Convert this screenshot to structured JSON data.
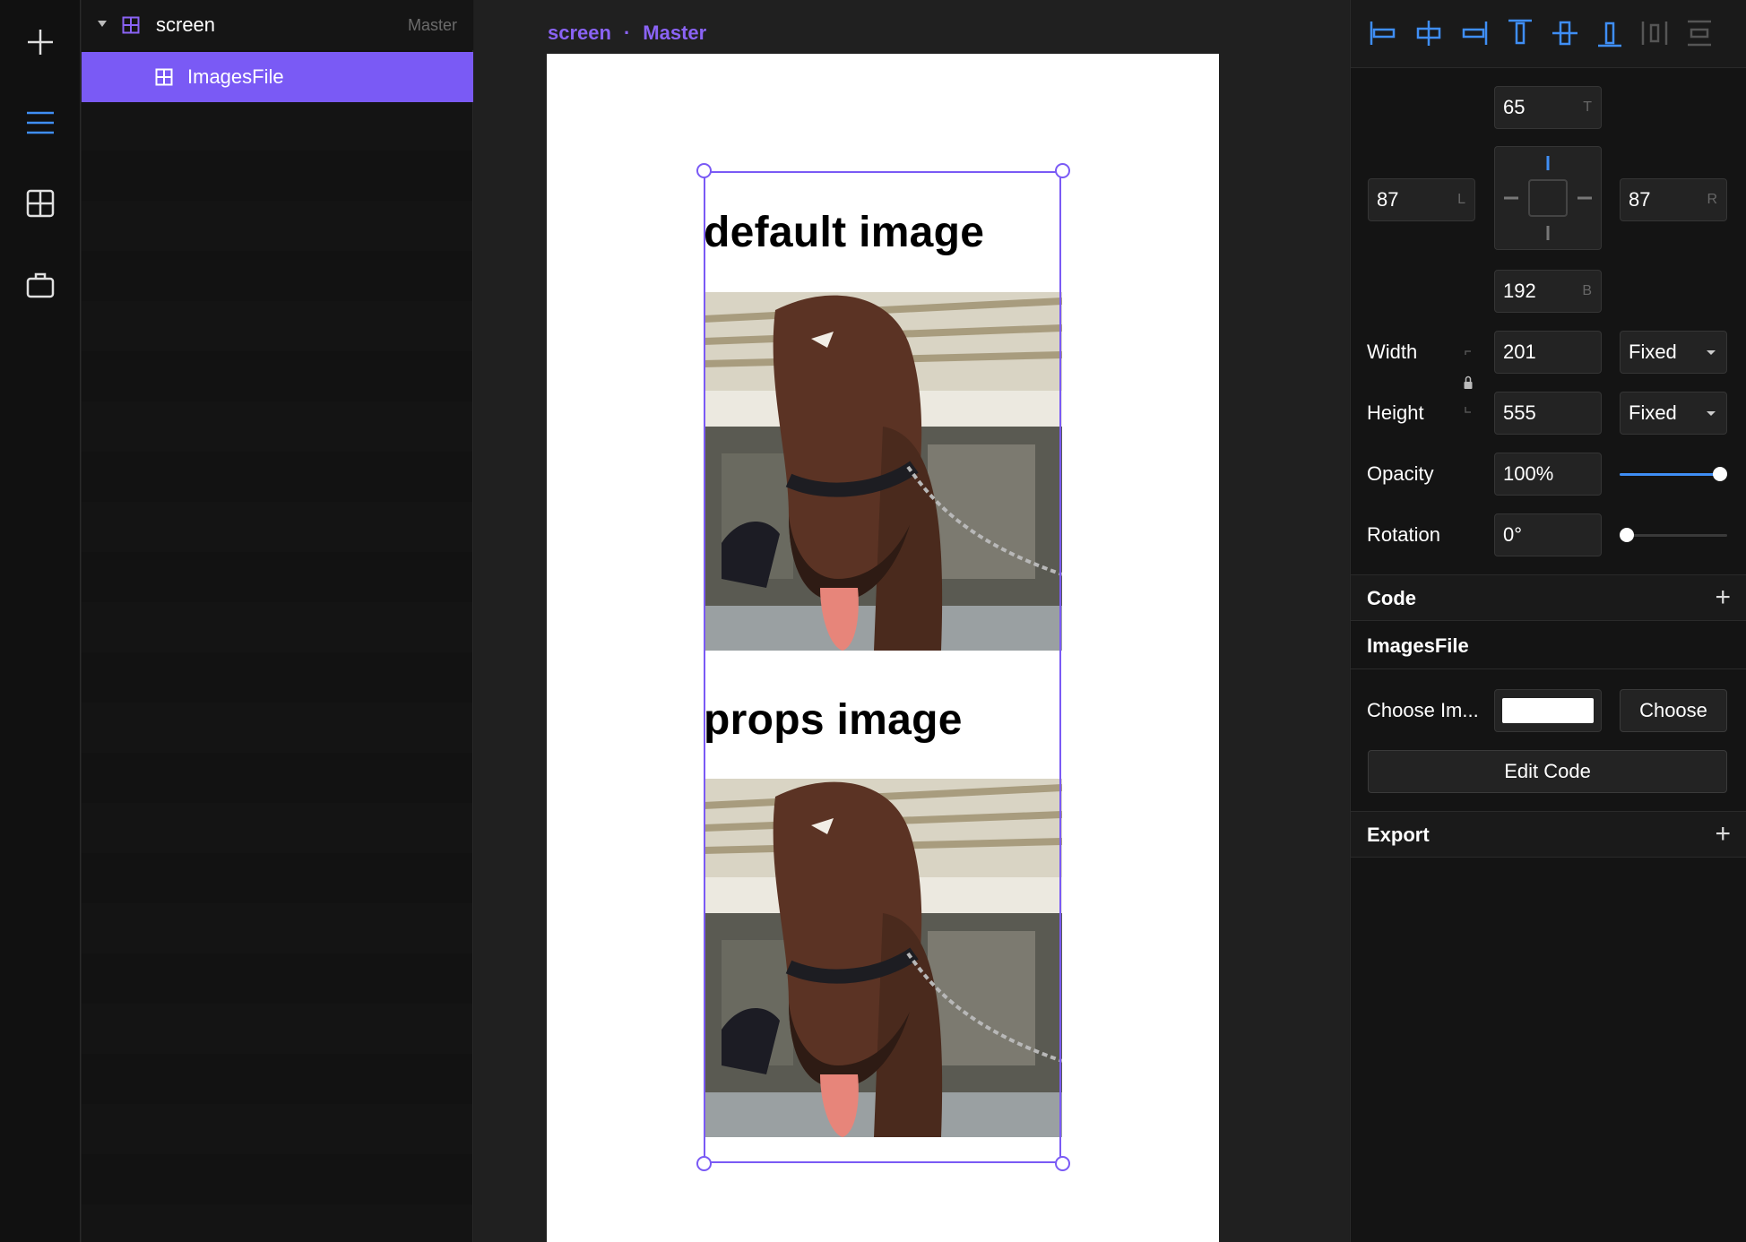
{
  "layers": {
    "items": [
      {
        "label": "screen",
        "tag": "Master"
      },
      {
        "label": "ImagesFile"
      }
    ]
  },
  "canvas": {
    "breadcrumb": [
      "screen",
      "Master"
    ],
    "separator": "·",
    "headings": [
      "default image",
      "props image"
    ]
  },
  "props": {
    "constraints": {
      "top": "65",
      "top_unit": "T",
      "left": "87",
      "left_unit": "L",
      "right": "87",
      "right_unit": "R",
      "bottom": "192",
      "bottom_unit": "B"
    },
    "width": {
      "label": "Width",
      "value": "201",
      "mode": "Fixed"
    },
    "height": {
      "label": "Height",
      "value": "555",
      "mode": "Fixed"
    },
    "opacity": {
      "label": "Opacity",
      "value": "100%",
      "level": 1.0
    },
    "rotation": {
      "label": "Rotation",
      "value": "0°",
      "level": 0.0
    },
    "code_section": {
      "title": "Code",
      "add": "+"
    },
    "component_section": {
      "title": "ImagesFile"
    },
    "choose_image": {
      "label": "Choose Im...",
      "button": "Choose"
    },
    "edit_code": "Edit Code",
    "export_section": {
      "title": "Export",
      "add": "+"
    }
  },
  "colors": {
    "accent": "#7a5af5",
    "blue": "#3f8ef5",
    "panel": "#141414"
  },
  "icons": [
    "plus-icon",
    "layers-icon",
    "components-icon",
    "store-icon",
    "grid-icon",
    "caret-down-icon",
    "lock-icon"
  ]
}
